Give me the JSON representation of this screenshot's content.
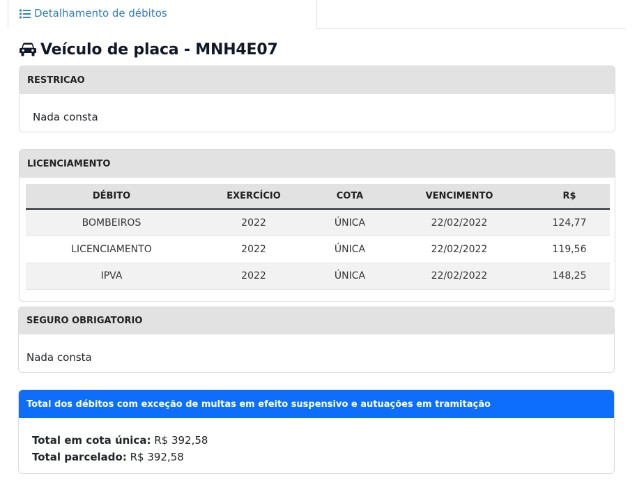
{
  "tab": {
    "label": "Detalhamento de débitos",
    "icon": "list-icon"
  },
  "page": {
    "title": "Veículo de placa - MNH4E07",
    "icon": "car-icon"
  },
  "restricao": {
    "title": "RESTRICAO",
    "text": "Nada consta"
  },
  "licenciamento": {
    "title": "LICENCIAMENTO",
    "columns": [
      "DÉBITO",
      "EXERCÍCIO",
      "COTA",
      "VENCIMENTO",
      "R$"
    ],
    "rows": [
      [
        "BOMBEIROS",
        "2022",
        "ÚNICA",
        "22/02/2022",
        "124,77"
      ],
      [
        "LICENCIAMENTO",
        "2022",
        "ÚNICA",
        "22/02/2022",
        "119,56"
      ],
      [
        "IPVA",
        "2022",
        "ÚNICA",
        "22/02/2022",
        "148,25"
      ]
    ]
  },
  "seguro": {
    "title": "SEGURO OBRIGATORIO",
    "text": "Nada consta"
  },
  "total": {
    "title": "Total dos débitos com exceção de multas em efeito suspensivo e autuações em tramitação",
    "cota_unica_label": "Total em cota única:",
    "cota_unica_value": "R$ 392,58",
    "parcelado_label": "Total parcelado:",
    "parcelado_value": "R$ 392,58"
  },
  "colors": {
    "tab_text": "#2e7fc4",
    "header_gray": "#e2e2e2",
    "total_header": "#0d6efd"
  }
}
